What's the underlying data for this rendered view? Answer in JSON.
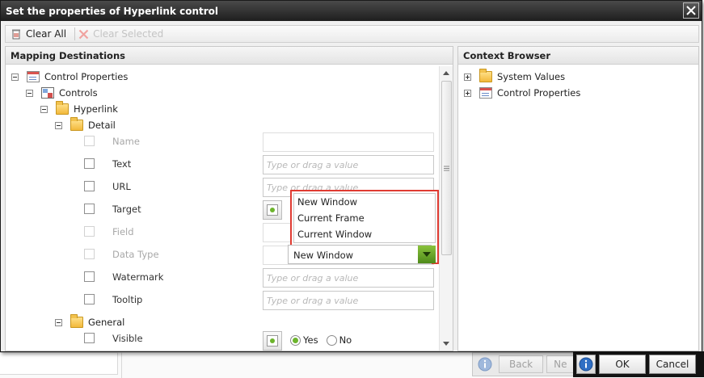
{
  "dialog": {
    "title": "Set the properties of Hyperlink control"
  },
  "toolbar": {
    "clear_all": "Clear All",
    "clear_selected": "Clear Selected"
  },
  "left_panel": {
    "header": "Mapping Destinations",
    "tree": {
      "root": "Control Properties",
      "controls": "Controls",
      "hyperlink": "Hyperlink",
      "detail": "Detail",
      "general": "General"
    },
    "properties": {
      "name": {
        "label": "Name",
        "value": ""
      },
      "text": {
        "label": "Text",
        "placeholder": "Type or drag a value"
      },
      "url": {
        "label": "URL",
        "placeholder": "Type or drag a value"
      },
      "target": {
        "label": "Target",
        "selected": "New Window"
      },
      "field": {
        "label": "Field",
        "value": ""
      },
      "data_type": {
        "label": "Data Type",
        "value": ""
      },
      "watermark": {
        "label": "Watermark",
        "placeholder": "Type or drag a value"
      },
      "tooltip": {
        "label": "Tooltip",
        "placeholder": "Type or drag a value"
      },
      "visible": {
        "label": "Visible",
        "yes": "Yes",
        "no": "No",
        "selected": "Yes"
      }
    },
    "target_options": [
      "New Window",
      "Current Frame",
      "Current Window"
    ]
  },
  "right_panel": {
    "header": "Context Browser",
    "items": [
      "System Values",
      "Control Properties"
    ]
  },
  "wizard_nav": {
    "back": "Back",
    "next": "Ne"
  },
  "actions": {
    "ok": "OK",
    "cancel": "Cancel"
  },
  "colors": {
    "accent_green": "#6cb42c",
    "highlight_red": "#e03b32",
    "info_blue": "#2f6fc4"
  }
}
